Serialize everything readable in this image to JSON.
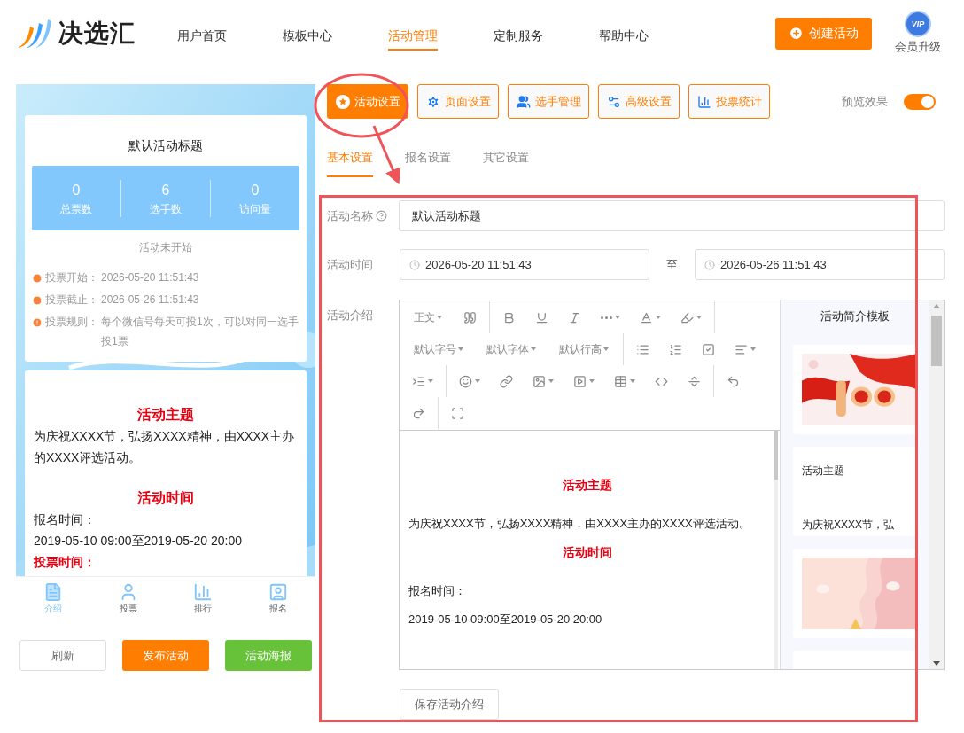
{
  "logo": {
    "text": "决选汇"
  },
  "nav": [
    {
      "label": "用户首页",
      "selected": false
    },
    {
      "label": "模板中心",
      "selected": false
    },
    {
      "label": "活动管理",
      "selected": true
    },
    {
      "label": "定制服务",
      "selected": false
    },
    {
      "label": "帮助中心",
      "selected": false
    }
  ],
  "create_button": "创建活动",
  "vip": {
    "badge": "VIP",
    "label": "会员升级"
  },
  "preview": {
    "title": "默认活动标题",
    "stats": [
      {
        "value": "0",
        "label": "总票数"
      },
      {
        "value": "6",
        "label": "选手数"
      },
      {
        "value": "0",
        "label": "访问量"
      }
    ],
    "status": "活动未开始",
    "info": [
      {
        "kind": "clock",
        "label": "投票开始：",
        "value": "2026-05-20 11:51:43"
      },
      {
        "kind": "clock",
        "label": "投票截止：",
        "value": "2026-05-26 11:51:43"
      },
      {
        "kind": "alert",
        "label": "投票规则：",
        "value": "每个微信号每天可投1次，可以对同一选手投1票"
      }
    ],
    "content": [
      {
        "kind": "heading",
        "text": "活动主题"
      },
      {
        "kind": "para",
        "text": "为庆祝XXXX节，弘扬XXXX精神，由XXXX主办的XXXX评选活动。"
      },
      {
        "kind": "heading",
        "text": "活动时间"
      },
      {
        "kind": "para",
        "text": "报名时间："
      },
      {
        "kind": "para",
        "text": "2019-05-10 09:00至2019-05-20 20:00"
      },
      {
        "kind": "label",
        "text": "投票时间："
      }
    ],
    "tabs": [
      {
        "label": "介绍",
        "selected": true
      },
      {
        "label": "投票",
        "selected": false
      },
      {
        "label": "排行",
        "selected": false
      },
      {
        "label": "报名",
        "selected": false
      }
    ]
  },
  "preview_buttons": [
    {
      "kind": "outline",
      "label": "刷新"
    },
    {
      "kind": "orange",
      "label": "发布活动"
    },
    {
      "kind": "green",
      "label": "活动海报"
    }
  ],
  "sections": [
    {
      "label": "活动设置",
      "selected": true
    },
    {
      "label": "页面设置",
      "selected": false
    },
    {
      "label": "选手管理",
      "selected": false
    },
    {
      "label": "高级设置",
      "selected": false
    },
    {
      "label": "投票统计",
      "selected": false
    }
  ],
  "preview_toggle": {
    "label": "预览效果",
    "on": true
  },
  "sub_tabs": [
    {
      "label": "基本设置",
      "selected": true
    },
    {
      "label": "报名设置",
      "selected": false
    },
    {
      "label": "其它设置",
      "selected": false
    }
  ],
  "form": {
    "name_label": "活动名称",
    "name_value": "默认活动标题",
    "time_label": "活动时间",
    "start": "2026-05-20 11:51:43",
    "separator": "至",
    "end": "2026-05-26 11:51:43",
    "intro_label": "活动介绍"
  },
  "editor": {
    "toolbar_labels": [
      "正文",
      "默认字号",
      "默认字体",
      "默认行高"
    ],
    "content": [
      {
        "kind": "heading",
        "text": "活动主题"
      },
      {
        "kind": "para",
        "text": "为庆祝XXXX节，弘扬XXXX精神，由XXXX主办的XXXX评选活动。"
      },
      {
        "kind": "heading",
        "text": "活动时间"
      },
      {
        "kind": "para",
        "text": "报名时间："
      },
      {
        "kind": "para",
        "text": "2019-05-10 09:00至2019-05-20 20:00"
      }
    ]
  },
  "templates": {
    "title": "活动简介模板",
    "cards": [
      {
        "kind": "picture"
      },
      {
        "kind": "text",
        "heading": "活动主题",
        "text": "为庆祝XXXX节，弘"
      },
      {
        "kind": "picture"
      },
      {
        "kind": "blank"
      }
    ]
  },
  "save_button": "保存活动介绍"
}
